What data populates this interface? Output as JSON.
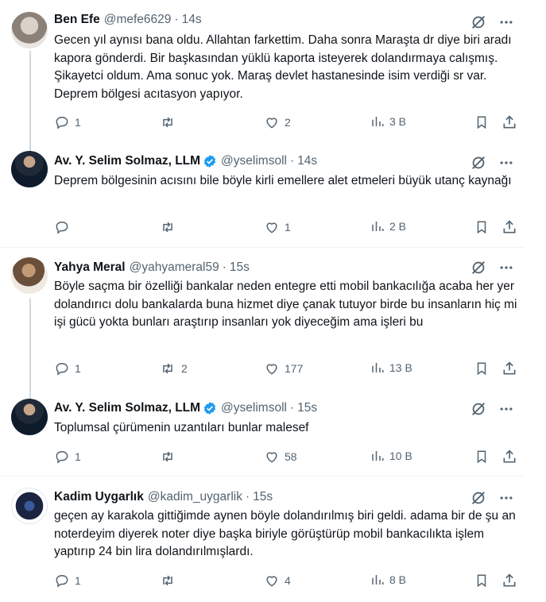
{
  "tweets": [
    {
      "name": "Ben Efe",
      "handle": "@mefe6629",
      "time": "14s",
      "verified": false,
      "text": "Gecen yıl aynısı bana oldu. Allahtan farkettim. Daha sonra Maraşta dr diye biri aradı kapora gönderdi. Bir başkasından yüklü kaporta isteyerek dolandırmaya calışmış. Şikayetci oldum. Ama sonuc yok. Maraş devlet hastanesinde isim verdiği sr var. Deprem bölgesi acıtasyon yapıyor.",
      "replies": "1",
      "reposts": "",
      "likes": "2",
      "views": "3 B"
    },
    {
      "name": "Av. Y. Selim Solmaz, LLM",
      "handle": "@yselimsoll",
      "time": "14s",
      "verified": true,
      "text": "Deprem bölgesinin acısını bile böyle kirli emellere alet etmeleri büyük utanç kaynağı",
      "replies": "",
      "reposts": "",
      "likes": "1",
      "views": "2 B"
    },
    {
      "name": "Yahya Meral",
      "handle": "@yahyameral59",
      "time": "15s",
      "verified": false,
      "text": "Böyle saçma bir özelliği bankalar neden entegre etti mobil bankacılığa acaba her yer dolandırıcı dolu bankalarda buna hizmet diye çanak tutuyor birde bu insanların hiç mi işi gücü yokta bunları araştırıp insanları yok diyeceğim ama işleri bu",
      "replies": "1",
      "reposts": "2",
      "likes": "177",
      "views": "13 B"
    },
    {
      "name": "Av. Y. Selim Solmaz, LLM",
      "handle": "@yselimsoll",
      "time": "15s",
      "verified": true,
      "text": "Toplumsal çürümenin uzantıları bunlar malesef",
      "replies": "1",
      "reposts": "",
      "likes": "58",
      "views": "10 B"
    },
    {
      "name": "Kadim Uygarlık",
      "handle": "@kadim_uygarlik",
      "time": "15s",
      "verified": false,
      "text": "geçen ay karakola gittiğimde aynen böyle dolandırılmış biri geldi. adama bir de şu an noterdeyim diyerek noter diye başka biriyle görüştürüp mobil bankacılıkta işlem yaptırıp 24 bin lira dolandırılmışlardı.",
      "replies": "1",
      "reposts": "",
      "likes": "4",
      "views": "8 B"
    }
  ],
  "dot": "·",
  "colors": {
    "verified": "#1d9bf0",
    "muted": "#536471",
    "line": "#cfd9de"
  }
}
